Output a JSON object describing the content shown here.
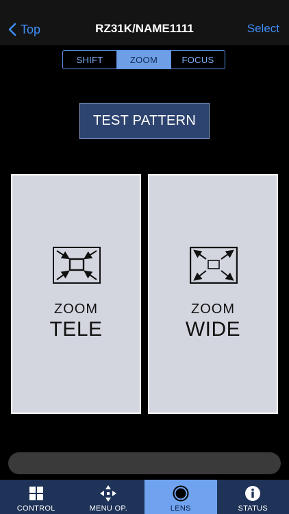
{
  "navbar": {
    "back_label": "Top",
    "title": "RZ31K/NAME1111",
    "select_label": "Select"
  },
  "segments": [
    {
      "label": "SHIFT",
      "active": false
    },
    {
      "label": "ZOOM",
      "active": true
    },
    {
      "label": "FOCUS",
      "active": false
    }
  ],
  "test_pattern": {
    "label": "TEST PATTERN"
  },
  "panels": {
    "tele": {
      "small": "ZOOM",
      "big": "TELE",
      "icon": "zoom-in-arrows-icon"
    },
    "wide": {
      "small": "ZOOM",
      "big": "WIDE",
      "icon": "zoom-out-arrows-icon"
    }
  },
  "tabs": [
    {
      "label": "CONTROL",
      "icon": "grid-icon"
    },
    {
      "label": "MENU OP.",
      "icon": "dpad-arrows-icon"
    },
    {
      "label": "LENS",
      "icon": "lens-icon",
      "active": true
    },
    {
      "label": "STATUS",
      "icon": "info-icon"
    }
  ],
  "colors": {
    "accent": "#3f8ef7",
    "segment_active": "#6e9fe6",
    "tab_bar": "#1f3358",
    "tab_active": "#6fa3f0",
    "panel_bg": "#d3d6df",
    "button_bg": "#2e4470"
  }
}
